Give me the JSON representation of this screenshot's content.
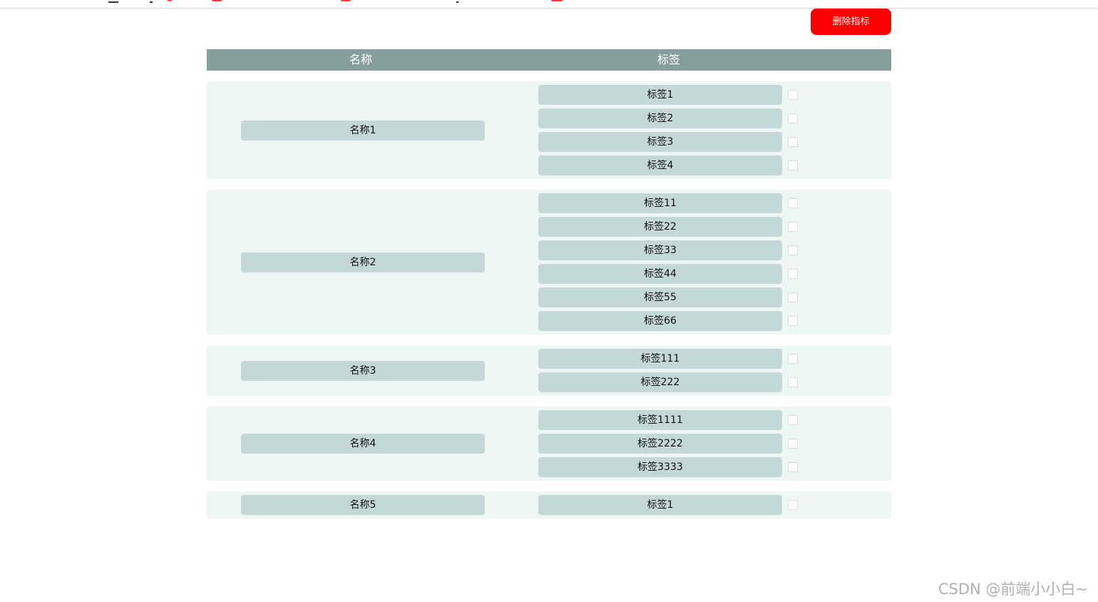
{
  "toolbar": {
    "delete_label": "删除指标"
  },
  "table": {
    "headers": {
      "name": "名称",
      "tag": "标签"
    },
    "groups": [
      {
        "name": "名称1",
        "tags": [
          {
            "label": "标签1",
            "checked": false
          },
          {
            "label": "标签2",
            "checked": false
          },
          {
            "label": "标签3",
            "checked": false
          },
          {
            "label": "标签4",
            "checked": false
          }
        ]
      },
      {
        "name": "名称2",
        "tags": [
          {
            "label": "标签11",
            "checked": false
          },
          {
            "label": "标签22",
            "checked": false
          },
          {
            "label": "标签33",
            "checked": false
          },
          {
            "label": "标签44",
            "checked": false
          },
          {
            "label": "标签55",
            "checked": false
          },
          {
            "label": "标签66",
            "checked": false
          }
        ]
      },
      {
        "name": "名称3",
        "tags": [
          {
            "label": "标签111",
            "checked": false
          },
          {
            "label": "标签222",
            "checked": false
          }
        ]
      },
      {
        "name": "名称4",
        "tags": [
          {
            "label": "标签1111",
            "checked": false
          },
          {
            "label": "标签2222",
            "checked": false
          },
          {
            "label": "标签3333",
            "checked": false
          }
        ]
      },
      {
        "name": "名称5",
        "tags": [
          {
            "label": "标签1",
            "checked": false
          }
        ]
      }
    ]
  },
  "watermark": "CSDN @前端小小白~",
  "colors": {
    "delete_button": "#ff0000",
    "header_bg": "#869e9b",
    "group_bg": "#eff7f5",
    "pill_bg": "#c4d8d8"
  }
}
